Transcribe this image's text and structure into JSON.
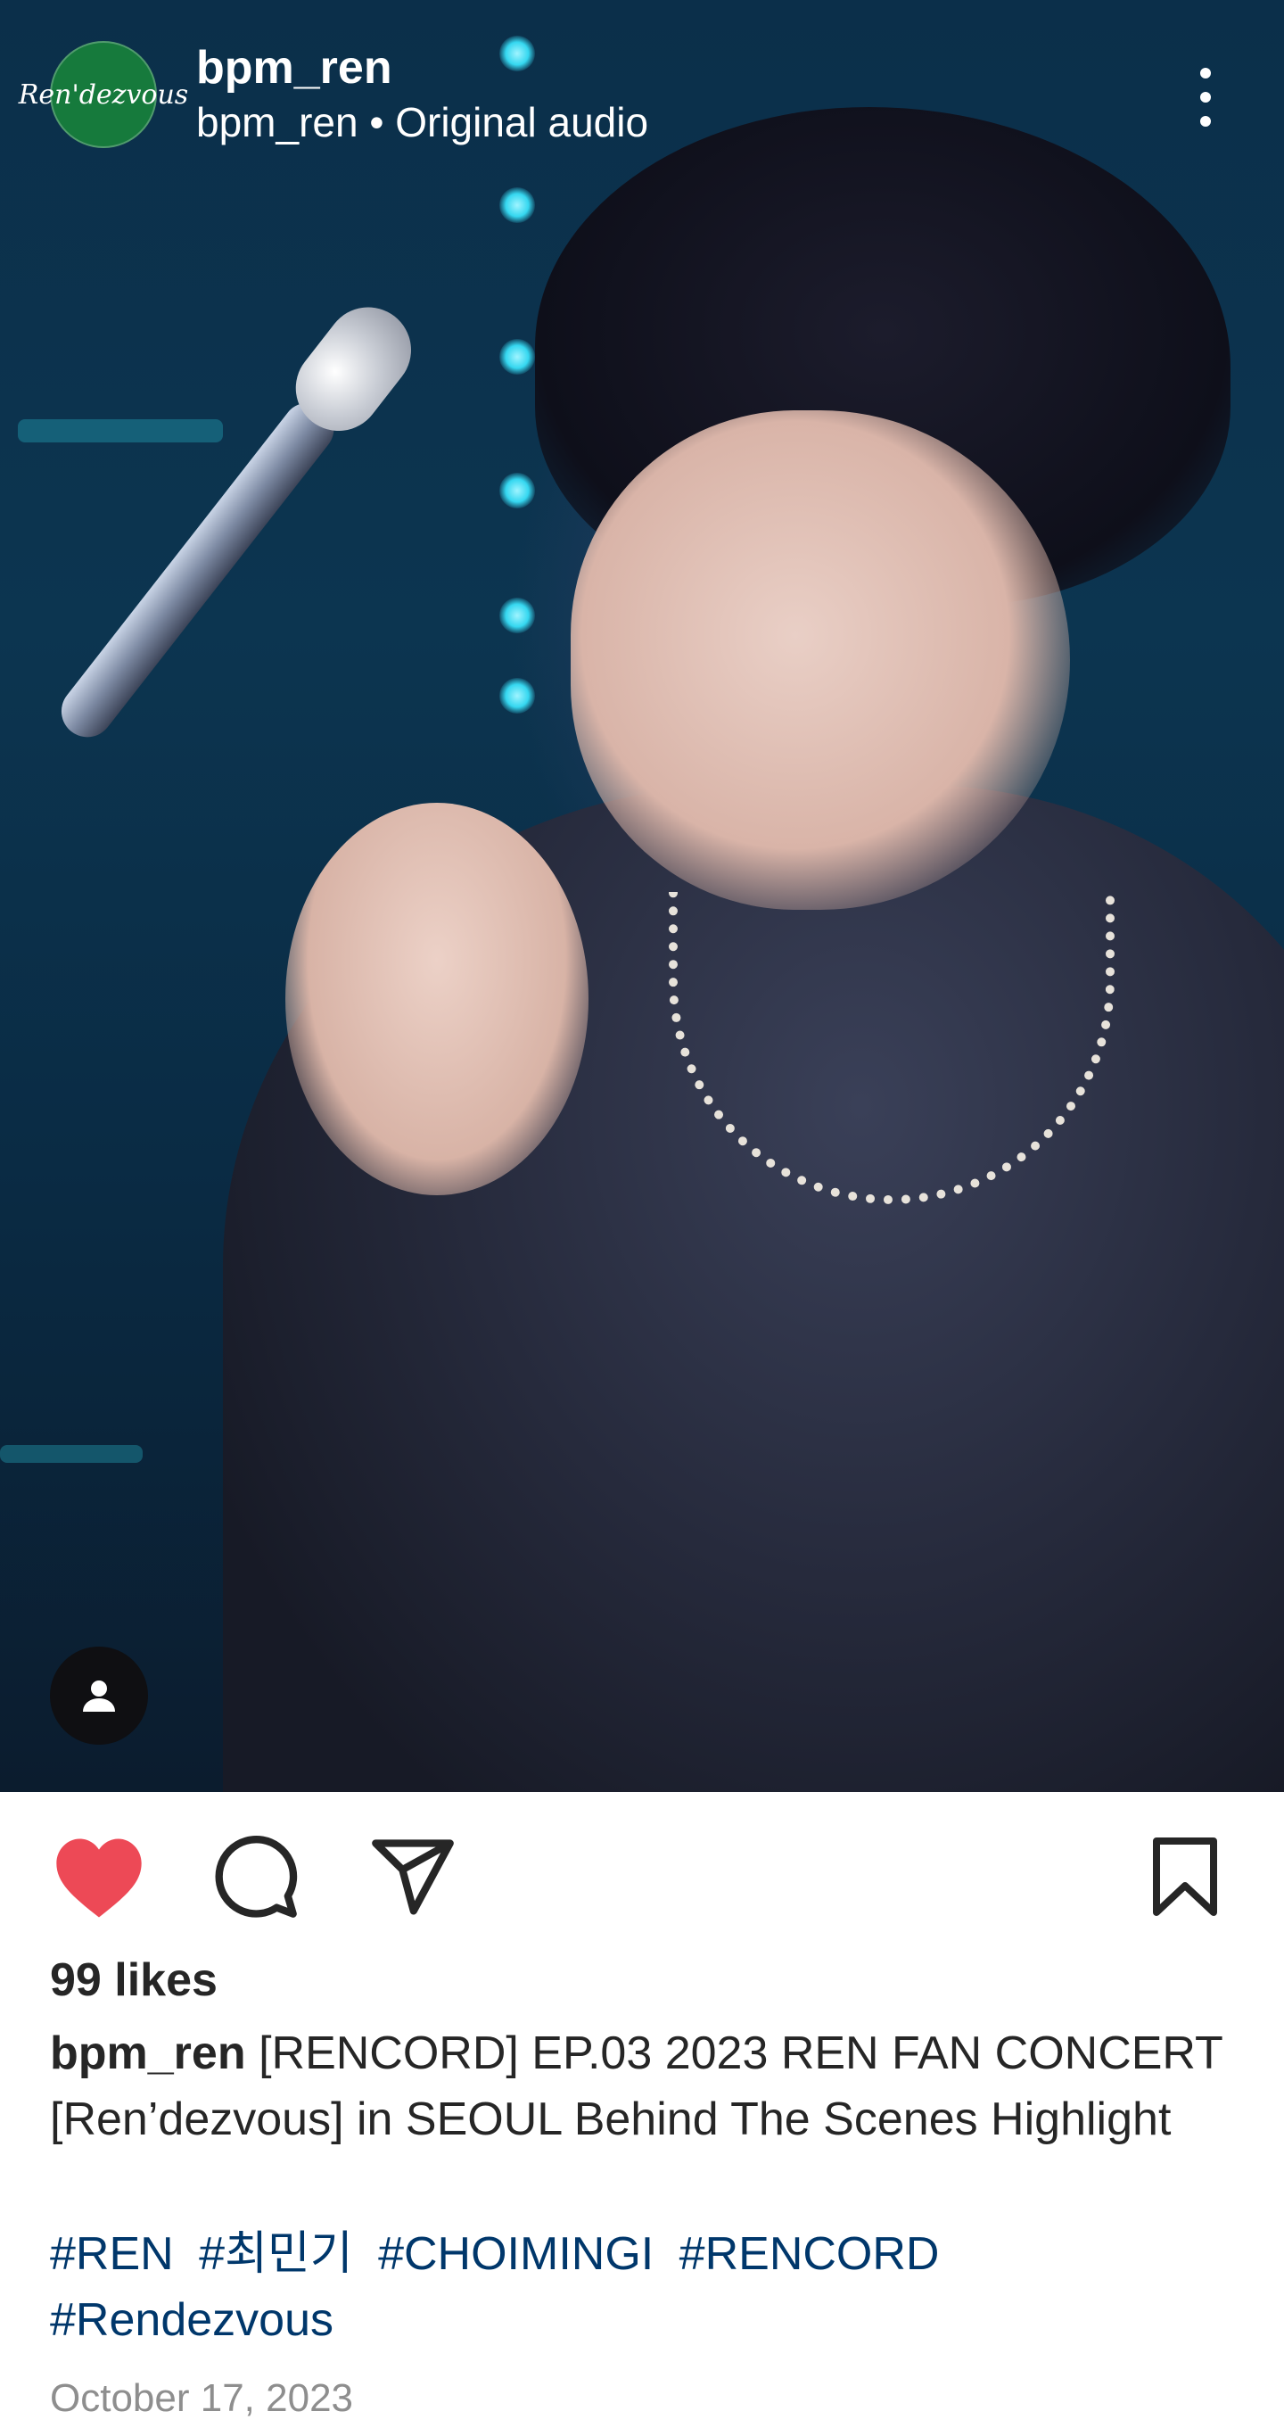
{
  "header": {
    "username": "bpm_ren",
    "audio_line": "bpm_ren • Original audio",
    "avatar_text": "Ren'dezvous"
  },
  "icons": {
    "more": "more-vertical-icon",
    "tag_people": "person-icon",
    "like": "heart-filled-icon",
    "comment": "comment-icon",
    "share": "send-icon",
    "save": "bookmark-icon"
  },
  "colors": {
    "like": "#ed4956",
    "hashtag": "#00376b",
    "avatar_bg": "#167a3c"
  },
  "post": {
    "likes": "99 likes",
    "caption_user": "bpm_ren",
    "caption_text": "[RENCORD] EP.03 2023 REN FAN CONCERT [Ren’dezvous] in SEOUL Behind The Scenes Highlight",
    "hashtags": [
      "#REN",
      "#최민기",
      "#CHOIMINGI",
      "#RENCORD",
      "#Rendezvous"
    ],
    "date": "October 17, 2023"
  }
}
